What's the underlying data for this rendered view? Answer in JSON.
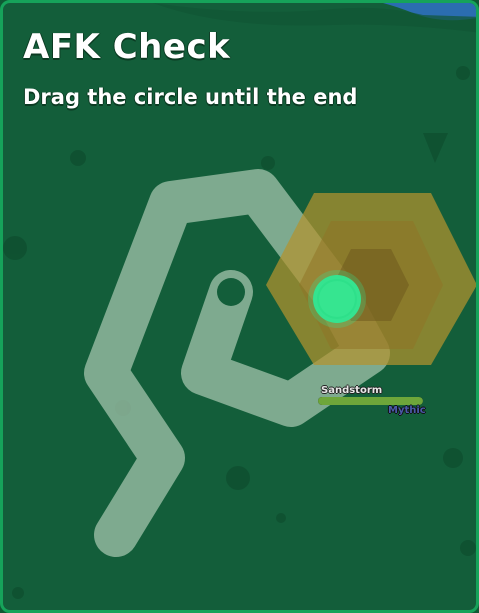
{
  "dialog": {
    "title": "AFK Check",
    "instruction": "Drag the circle until the end"
  },
  "mob": {
    "name": "Sandstorm",
    "rarity": "Mythic",
    "health_fraction": 1.0,
    "rarity_color": "#4a5aa8"
  },
  "colors": {
    "background": "#135e3a",
    "border": "#16a35a",
    "path": "#a7c7b0",
    "handle": "#2fe08a",
    "mob_fill": "#b3932e"
  }
}
